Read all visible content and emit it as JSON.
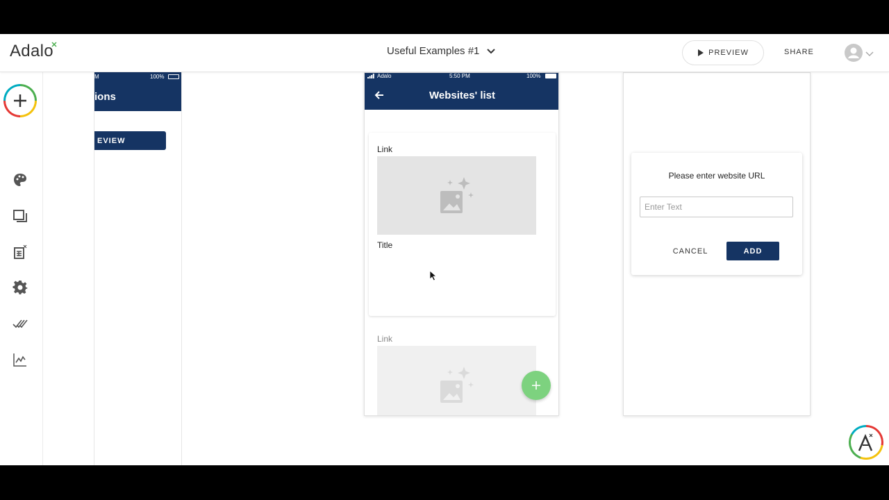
{
  "header": {
    "logo": "Adalo",
    "app_title": "Useful Examples #1",
    "preview_label": "PREVIEW",
    "share_label": "SHARE"
  },
  "toolbar": {
    "items": [
      "add",
      "branding",
      "screens",
      "database",
      "settings",
      "publish",
      "analytics"
    ]
  },
  "screen1": {
    "status_time": "M",
    "status_battery": "100%",
    "title": "ions",
    "button_label": "EVIEW"
  },
  "screen2": {
    "status_carrier": "Adalo",
    "status_time": "5:50 PM",
    "status_battery": "100%",
    "title": "Websites' list",
    "cards": [
      {
        "link": "Link",
        "title": "Title"
      },
      {
        "link": "Link"
      }
    ]
  },
  "dialog": {
    "title": "Please enter website URL",
    "input_placeholder": "Enter Text",
    "cancel_label": "CANCEL",
    "add_label": "ADD"
  },
  "colors": {
    "primary": "#153463",
    "fab": "#7dd27f",
    "placeholder_bg": "#e4e4e4"
  }
}
